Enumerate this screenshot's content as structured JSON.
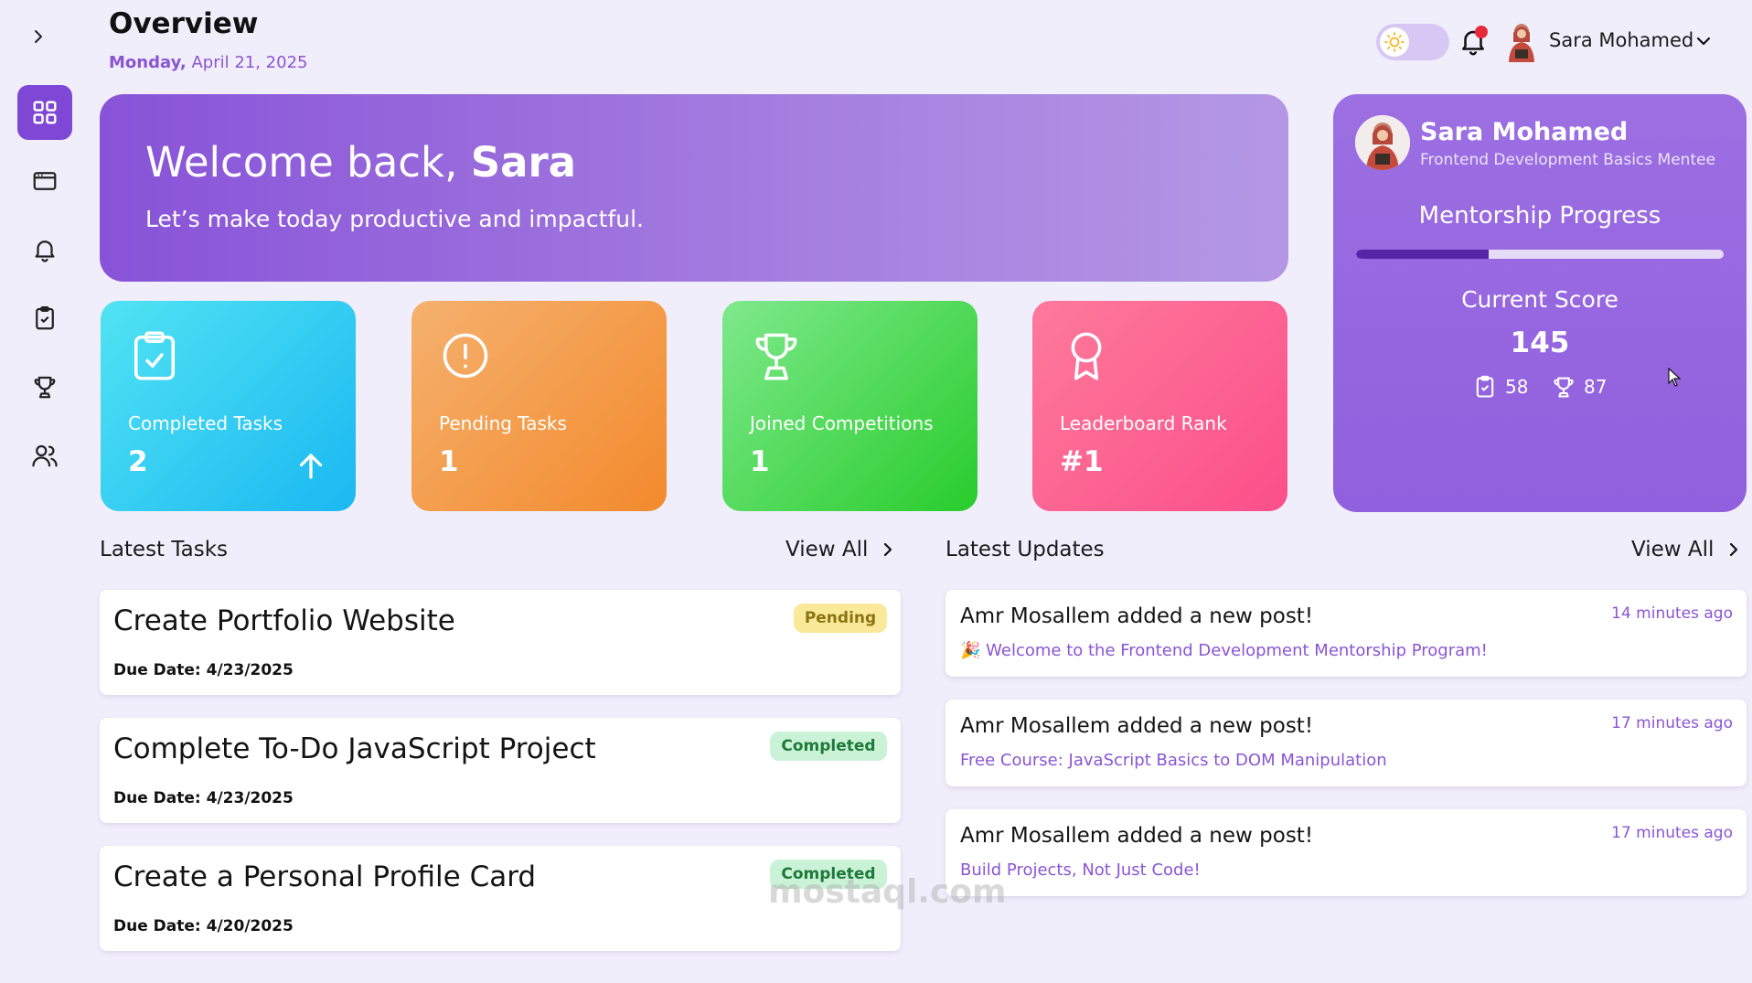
{
  "header": {
    "title": "Overview",
    "date_day": "Monday,",
    "date_rest": " April 21, 2025",
    "user_name": "Sara Mohamed"
  },
  "banner": {
    "greeting": "Welcome back, ",
    "name": "Sara",
    "subtitle": "Let’s make today productive and impactful."
  },
  "stats": [
    {
      "label": "Completed Tasks",
      "value": "2",
      "icon": "clipboard-check-icon",
      "color": "#1bb8f2"
    },
    {
      "label": "Pending Tasks",
      "value": "1",
      "icon": "alert-circle-icon",
      "color": "#f38a2d"
    },
    {
      "label": "Joined Competitions",
      "value": "1",
      "icon": "trophy-icon",
      "color": "#28cc2c"
    },
    {
      "label": "Leaderboard Rank",
      "value": "#1",
      "icon": "award-ribbon-icon",
      "color": "#fc4f8a"
    }
  ],
  "profile": {
    "name": "Sara Mohamed",
    "role": "Frontend Development Basics Mentee",
    "progress_title": "Mentorship Progress",
    "progress_fraction": 0.36,
    "score_title": "Current Score",
    "score": "145",
    "tasks_points": "58",
    "competition_points": "87"
  },
  "tasks_section": {
    "title": "Latest Tasks",
    "view_all": "View All",
    "items": [
      {
        "title": "Create Portfolio Website",
        "due": "Due Date: 4/23/2025",
        "status": "Pending"
      },
      {
        "title": "Complete To-Do JavaScript Project",
        "due": "Due Date: 4/23/2025",
        "status": "Completed"
      },
      {
        "title": "Create a Personal Profile Card",
        "due": "Due Date: 4/20/2025",
        "status": "Completed"
      }
    ]
  },
  "updates_section": {
    "title": "Latest Updates",
    "view_all": "View All",
    "items": [
      {
        "title": "Amr Mosallem added a new post!",
        "text": "🎉 Welcome to the Frontend Development Mentorship Program!",
        "time": "14 minutes ago"
      },
      {
        "title": "Amr Mosallem added a new post!",
        "text": "Free Course: JavaScript Basics to DOM Manipulation",
        "time": "17 minutes ago"
      },
      {
        "title": "Amr Mosallem added a new post!",
        "text": "Build Projects, Not Just Code!",
        "time": "17 minutes ago"
      }
    ]
  },
  "watermark": "mostaql.com",
  "colors": {
    "accent": "#7f47d6",
    "background": "#f1eefb"
  }
}
